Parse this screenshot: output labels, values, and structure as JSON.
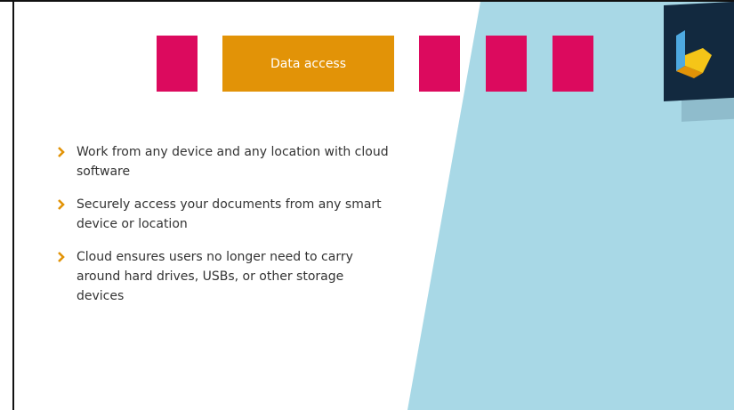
{
  "tabs": [
    {
      "label": "",
      "color": "#dc0a5e"
    },
    {
      "label": "Data access",
      "color": "#e29307"
    },
    {
      "label": "",
      "color": "#dc0a5e"
    },
    {
      "label": "",
      "color": "#dc0a5e"
    },
    {
      "label": "",
      "color": "#dc0a5e"
    }
  ],
  "bullets": [
    "Work from any device and any location with cloud software",
    "Securely access your documents from any smart device or location",
    "Cloud ensures users no longer need to carry around hard drives, USBs, or other storage devices"
  ],
  "colors": {
    "accent_pink": "#dc0a5e",
    "accent_orange": "#e29307",
    "panel_blue": "#a8d8e6",
    "logo_bg": "#12293f",
    "bullet_marker": "#e29307"
  },
  "logo": {
    "icon": "brand-b-logo-icon"
  }
}
